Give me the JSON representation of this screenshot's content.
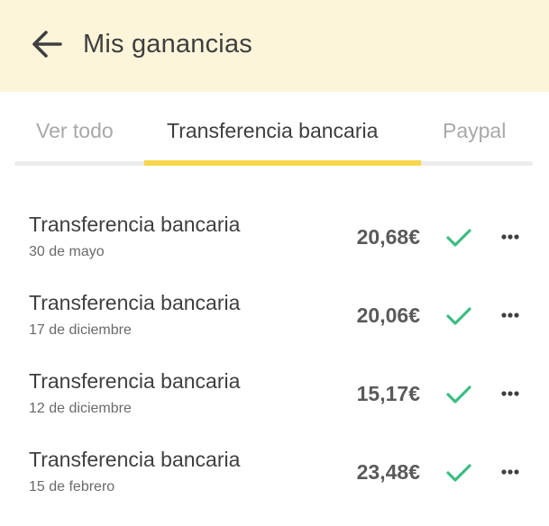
{
  "header": {
    "title": "Mis ganancias",
    "back_icon": "arrow-left-icon"
  },
  "tabs": [
    {
      "label": "Ver todo",
      "active": false
    },
    {
      "label": "Transferencia bancaria",
      "active": true
    },
    {
      "label": "Paypal",
      "active": false
    }
  ],
  "transactions": [
    {
      "title": "Transferencia bancaria",
      "date": "30 de mayo",
      "amount": "20,68€",
      "status_icon": "check-icon",
      "menu_icon": "more-horizontal-icon"
    },
    {
      "title": "Transferencia bancaria",
      "date": "17 de diciembre",
      "amount": "20,06€",
      "status_icon": "check-icon",
      "menu_icon": "more-horizontal-icon"
    },
    {
      "title": "Transferencia bancaria",
      "date": "12 de diciembre",
      "amount": "15,17€",
      "status_icon": "check-icon",
      "menu_icon": "more-horizontal-icon"
    },
    {
      "title": "Transferencia bancaria",
      "date": "15 de febrero",
      "amount": "23,48€",
      "status_icon": "check-icon",
      "menu_icon": "more-horizontal-icon"
    }
  ],
  "colors": {
    "header_bg": "#fdf5da",
    "tab_indicator": "#f7d64a",
    "check": "#3dbd82",
    "text_primary": "#3f3f3f"
  }
}
